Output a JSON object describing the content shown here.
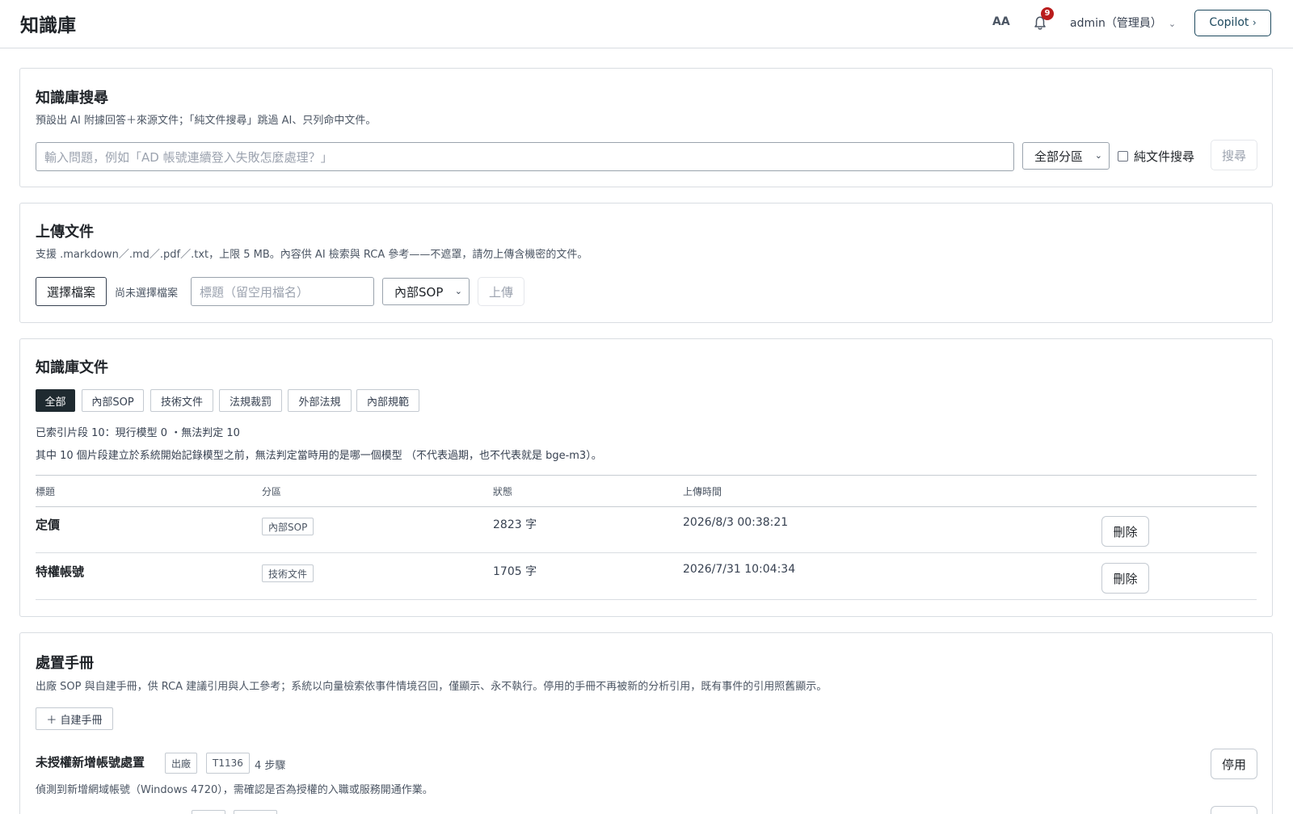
{
  "header": {
    "title": "知識庫",
    "font_toggle": "AA",
    "notification_count": "9",
    "user": "admin（管理員）",
    "copilot": "Copilot"
  },
  "search": {
    "title": "知識庫搜尋",
    "desc": "預設出 AI 附據回答＋來源文件；「純文件搜尋」跳過 AI、只列命中文件。",
    "placeholder": "輸入問題，例如「AD 帳號連續登入失敗怎麼處理？」",
    "partition": "全部分區",
    "docs_only": "純文件搜尋",
    "submit": "搜尋"
  },
  "upload": {
    "title": "上傳文件",
    "desc": "支援 .markdown／.md／.pdf／.txt，上限 5 MB。內容供 AI 檢索與 RCA 參考——不遮罩，請勿上傳含機密的文件。",
    "choose_file": "選擇檔案",
    "no_file": "尚未選擇檔案",
    "title_placeholder": "標題（留空用檔名）",
    "partition": "內部SOP",
    "submit": "上傳"
  },
  "documents": {
    "title": "知識庫文件",
    "tabs": [
      "全部",
      "內部SOP",
      "技術文件",
      "法規裁罰",
      "外部法規",
      "內部規範"
    ],
    "stats_line": "已索引片段 10：現行模型 0 ・無法判定 10",
    "stats_note": "其中 10 個片段建立於系統開始記錄模型之前，無法判定當時用的是哪一個模型 （不代表過期，也不代表就是 bge-m3）。",
    "columns": [
      "標題",
      "分區",
      "狀態",
      "上傳時間"
    ],
    "rows": [
      {
        "title": "定價",
        "partition": "內部SOP",
        "status": "2823 字",
        "uploaded": "2026/8/3 00:38:21",
        "action": "刪除"
      },
      {
        "title": "特權帳號",
        "partition": "技術文件",
        "status": "1705 字",
        "uploaded": "2026/7/31 10:04:34",
        "action": "刪除"
      }
    ]
  },
  "playbooks": {
    "title": "處置手冊",
    "desc": "出廠 SOP 與自建手冊，供 RCA 建議引用與人工參考；系統以向量檢索依事件情境召回，僅顯示、永不執行。停用的手冊不再被新的分析引用，既有事件的引用照舊顯示。",
    "create": "＋ 自建手冊",
    "items": [
      {
        "title": "未授權新增帳號處置",
        "source": "出廠",
        "technique": "T1136",
        "steps": "4 步驟",
        "desc": "偵測到新增網域帳號（Windows 4720），需確認是否為授權的入職或服務開通作業。",
        "action": "停用"
      }
    ]
  }
}
